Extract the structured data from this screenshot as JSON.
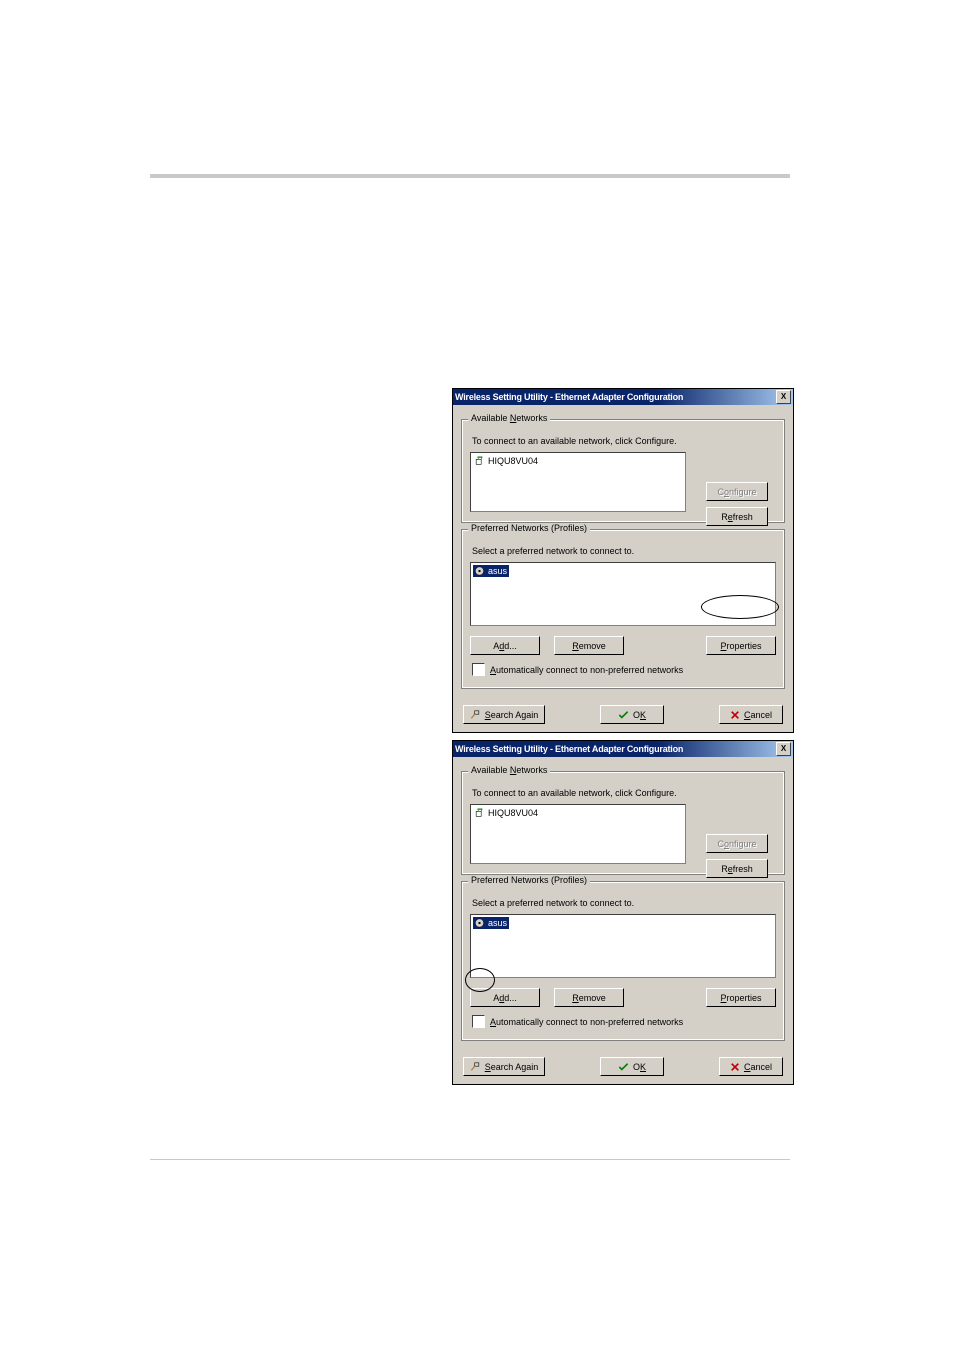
{
  "dialog": {
    "title": "Wireless Setting Utility - Ethernet Adapter Configuration",
    "available": {
      "legend": "Available Networks",
      "hint": "To connect to an available network, click Configure.",
      "items": [
        {
          "name": "HIQU8VU04"
        }
      ],
      "configure": "Configure",
      "refresh": "Refresh"
    },
    "preferred": {
      "legend": "Preferred Networks (Profiles)",
      "hint": "Select a preferred network to connect to.",
      "items": [
        {
          "name": "asus"
        }
      ],
      "add": "Add...",
      "remove": "Remove",
      "properties": "Properties"
    },
    "auto": "Automatically connect to non-preferred networks",
    "search": "Search Again",
    "ok": "OK",
    "cancel": "Cancel",
    "close": "X"
  }
}
